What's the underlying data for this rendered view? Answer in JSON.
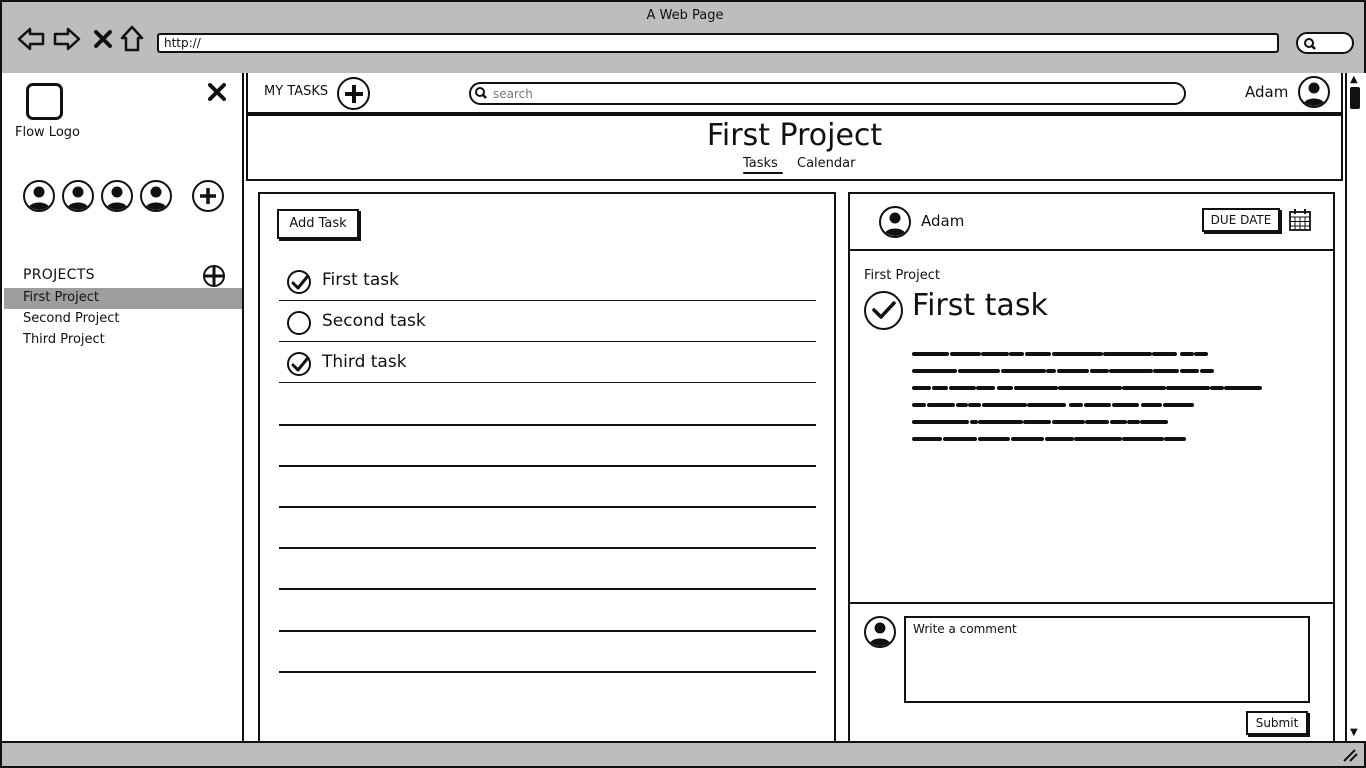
{
  "window": {
    "title": "A Web Page",
    "url": "http://"
  },
  "icons": {
    "back": "back-arrow-icon",
    "forward": "forward-arrow-icon",
    "stop": "stop-x-icon",
    "home": "home-icon",
    "browser_search": "search-icon",
    "close": "close-icon",
    "add": "plus-circle-icon",
    "user": "user-avatar-icon",
    "check": "check-circle-icon",
    "calendar": "calendar-icon"
  },
  "sidebar": {
    "logo_label": "Flow Logo",
    "projects_heading": "PROJECTS",
    "projects": [
      {
        "label": "First Project",
        "active": true
      },
      {
        "label": "Second Project",
        "active": false
      },
      {
        "label": "Third Project",
        "active": false
      }
    ]
  },
  "topbar": {
    "my_tasks_label": "MY TASKS",
    "search_placeholder": "search",
    "user_name": "Adam"
  },
  "project": {
    "title": "First Project",
    "tabs": [
      {
        "label": "Tasks",
        "active": true
      },
      {
        "label": "Calendar",
        "active": false
      }
    ]
  },
  "task_list": {
    "add_task_label": "Add Task",
    "tasks": [
      {
        "label": "First task",
        "done": true
      },
      {
        "label": "Second task",
        "done": false
      },
      {
        "label": "Third task",
        "done": true
      }
    ]
  },
  "detail": {
    "assignee": "Adam",
    "due_date_label": "DUE DATE",
    "project_name": "First Project",
    "task_title": "First task",
    "task_done": true,
    "comment_placeholder": "Write a comment",
    "submit_label": "Submit"
  }
}
